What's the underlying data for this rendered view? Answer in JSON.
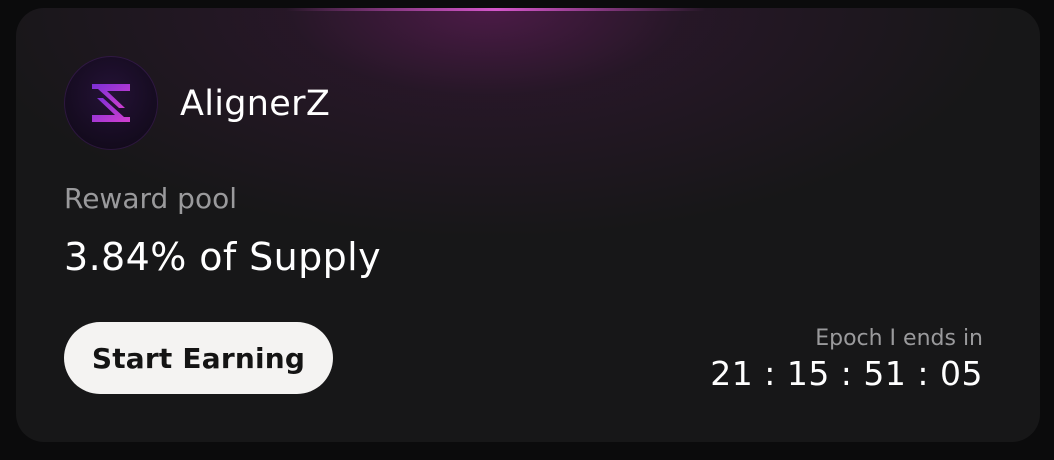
{
  "brand": {
    "name": "AlignerZ",
    "logo_icon": "alignerz-logo-icon"
  },
  "reward": {
    "label": "Reward pool",
    "value": "3.84% of Supply"
  },
  "cta": {
    "label": "Start Earning"
  },
  "epoch": {
    "label": "Epoch I ends in",
    "countdown": "21 : 15 : 51 : 05"
  },
  "colors": {
    "accent": "#c03ad6",
    "accent_dark": "#7b2fd6",
    "card_bg": "#171718",
    "text_primary": "#ffffff",
    "text_secondary": "#9a9a9c",
    "button_bg": "#f4f3f2"
  }
}
